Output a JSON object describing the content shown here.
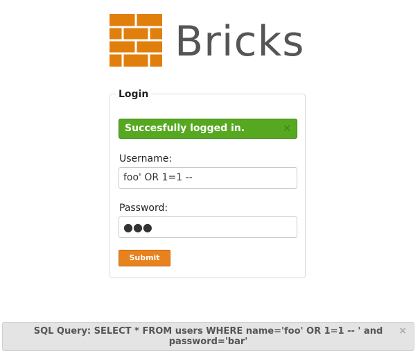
{
  "app": {
    "name": "Bricks",
    "logo_icon": "bricks-logo-icon",
    "brand_color": "#e07f0c"
  },
  "login": {
    "legend": "Login",
    "alert": {
      "message": "Succesfully logged in.",
      "close_glyph": "×",
      "color": "#55a81f"
    },
    "username": {
      "label": "Username:",
      "value": "foo' OR 1=1 --"
    },
    "password": {
      "label": "Password:",
      "masked_value": "●●●"
    },
    "submit_label": "Submit",
    "submit_color": "#e8821e"
  },
  "sql_notice": {
    "text": "SQL Query: SELECT * FROM users WHERE name='foo' OR 1=1 -- ' and password='bar'",
    "close_glyph": "×"
  }
}
